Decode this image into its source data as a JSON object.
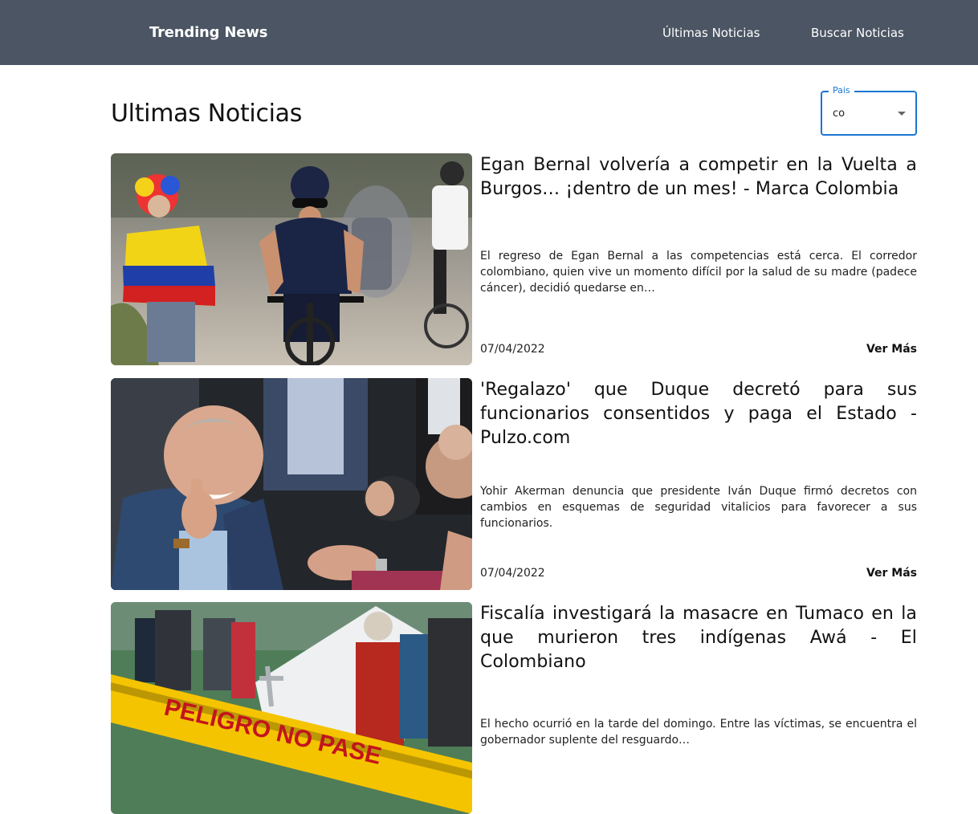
{
  "header": {
    "brand": "Trending News",
    "nav": [
      "Últimas Noticias",
      "Buscar Noticias"
    ]
  },
  "page_title": "Ultimas Noticias",
  "country_select": {
    "label": "Pais",
    "value": "co"
  },
  "articles": [
    {
      "title": "Egan Bernal volvería a competir en la Vuelta a Burgos… ¡dentro de un mes! - Marca Colombia",
      "summary": "El regreso de Egan Bernal a las competencias está cerca. El corredor colombiano, quien vive un momento difícil por la salud de su madre (padece cáncer), decidió quedarse en…",
      "date": "07/04/2022",
      "more": "Ver Más"
    },
    {
      "title": "'Regalazo' que Duque decretó para sus funcionarios consentidos y paga el Estado - Pulzo.com",
      "summary": "Yohir Akerman denuncia que presidente Iván Duque firmó decretos con cambios en esquemas de seguridad vitalicios para favorecer a sus funcionarios.",
      "date": "07/04/2022",
      "more": "Ver Más"
    },
    {
      "title": "Fiscalía investigará la masacre en Tumaco en la que murieron tres indígenas Awá - El Colombiano",
      "summary": "El hecho ocurrió en la tarde del domingo. Entre las víctimas, se encuentra el gobernador suplente del resguardo…",
      "image_text": "PELIGRO NO PASE"
    }
  ],
  "colors": {
    "topbar": "#4b5563",
    "accent": "#1976d2"
  }
}
